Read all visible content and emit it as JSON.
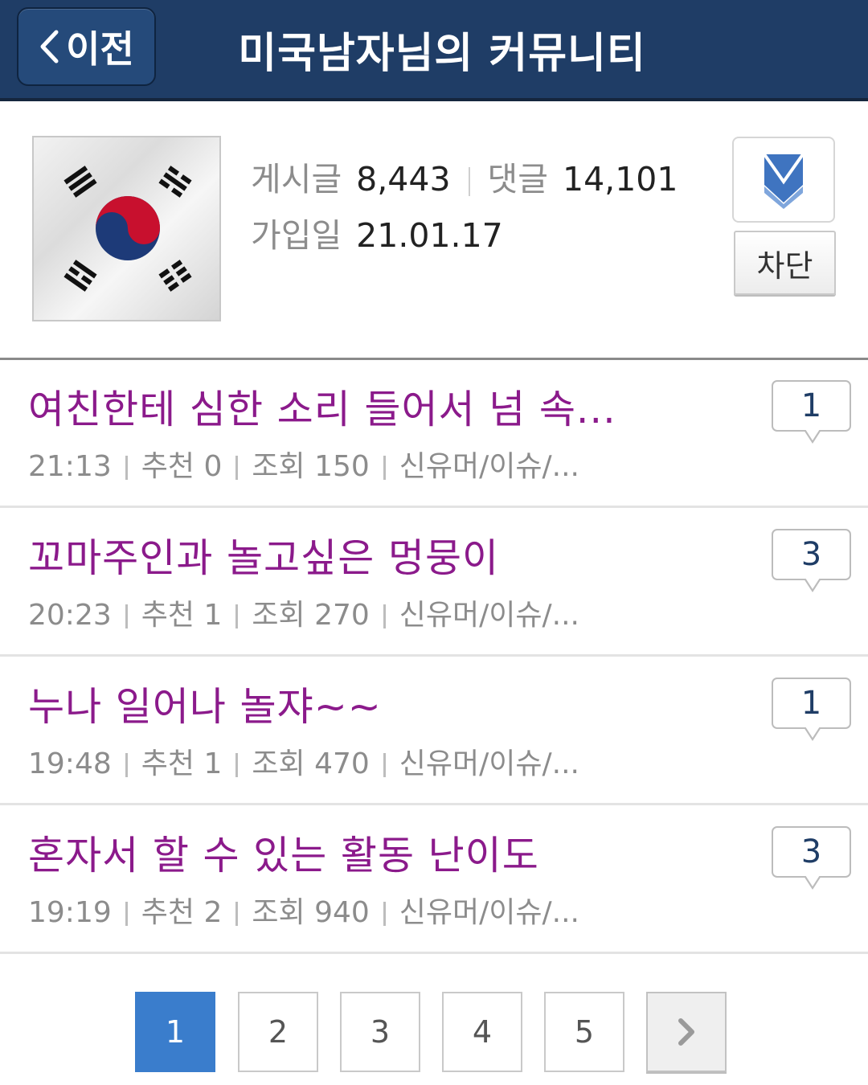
{
  "header": {
    "back_label": "이전",
    "title": "미국남자님의 커뮤니티"
  },
  "profile": {
    "posts_label": "게시글",
    "posts_value": "8,443",
    "comments_label": "댓글",
    "comments_value": "14,101",
    "joined_label": "가입일",
    "joined_value": "21.01.17",
    "block_label": "차단",
    "avatar": "korean-flag"
  },
  "posts": [
    {
      "title": "여친한테 심한 소리 들어서 넘 속...",
      "time": "21:13",
      "rec_label": "추천",
      "rec": "0",
      "views_label": "조회",
      "views": "150",
      "board": "신유머/이슈/...",
      "comments": "1"
    },
    {
      "title": "꼬마주인과 놀고싶은 멍뭉이",
      "time": "20:23",
      "rec_label": "추천",
      "rec": "1",
      "views_label": "조회",
      "views": "270",
      "board": "신유머/이슈/...",
      "comments": "3"
    },
    {
      "title": "누나 일어나 놀쟈~~",
      "time": "19:48",
      "rec_label": "추천",
      "rec": "1",
      "views_label": "조회",
      "views": "470",
      "board": "신유머/이슈/...",
      "comments": "1"
    },
    {
      "title": "혼자서 할 수 있는 활동 난이도",
      "time": "19:19",
      "rec_label": "추천",
      "rec": "2",
      "views_label": "조회",
      "views": "940",
      "board": "신유머/이슈/...",
      "comments": "3"
    }
  ],
  "pagination": {
    "pages": [
      "1",
      "2",
      "3",
      "4",
      "5"
    ],
    "current": "1",
    "next_icon": "chevron-right-icon"
  },
  "colors": {
    "header_bg": "#1f3d66",
    "title_purple": "#8b1a8b",
    "active_page": "#3a7dcc"
  }
}
